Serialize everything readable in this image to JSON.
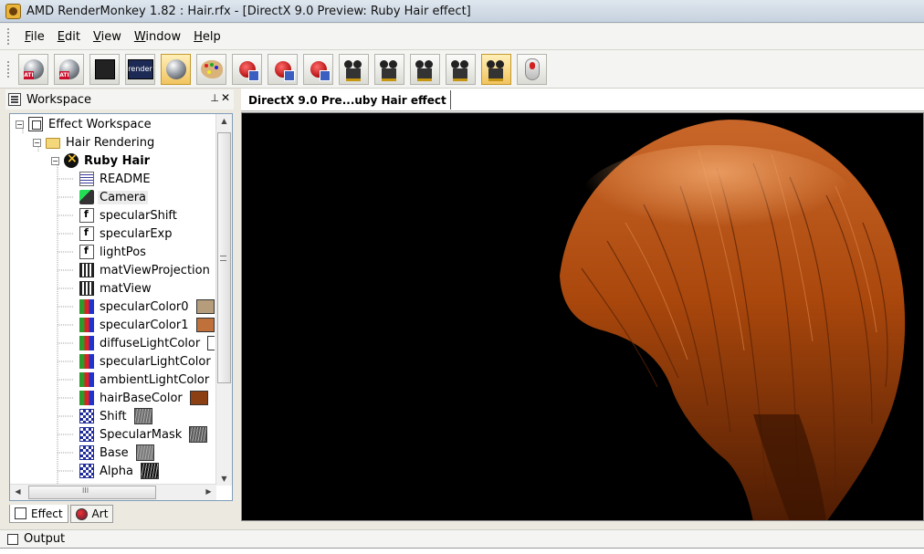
{
  "window": {
    "title": "AMD RenderMonkey 1.82 : Hair.rfx - [DirectX 9.0 Preview: Ruby Hair effect]"
  },
  "menu": [
    {
      "key": "F",
      "rest": "ile"
    },
    {
      "key": "E",
      "rest": "dit"
    },
    {
      "key": "V",
      "rest": "iew"
    },
    {
      "key": "W",
      "rest": "indow"
    },
    {
      "key": "H",
      "rest": "elp"
    }
  ],
  "toolbar": {
    "render_label": "render",
    "ati_badge": "ATI"
  },
  "workspace": {
    "title": "Workspace",
    "pin_glyph": "⊥",
    "close_glyph": "✕",
    "tree": [
      {
        "label": "Effect Workspace",
        "icon": "workspace-icon",
        "level": 0
      },
      {
        "label": "Hair Rendering",
        "icon": "folder-icon",
        "level": 1
      },
      {
        "label": "Ruby Hair",
        "icon": "effect-icon",
        "level": 2
      },
      {
        "label": "README",
        "icon": "readme-icon",
        "level": 3
      },
      {
        "label": "Camera",
        "icon": "camera-icon",
        "level": 3
      },
      {
        "label": "specularShift",
        "icon": "scalar-icon",
        "level": 3
      },
      {
        "label": "specularExp",
        "icon": "scalar-icon",
        "level": 3
      },
      {
        "label": "lightPos",
        "icon": "scalar-icon",
        "level": 3
      },
      {
        "label": "matViewProjection",
        "icon": "matrix-icon",
        "level": 3
      },
      {
        "label": "matView",
        "icon": "matrix-icon",
        "level": 3
      },
      {
        "label": "specularColor0",
        "icon": "color-icon",
        "level": 3,
        "swatch": "#b59d7c"
      },
      {
        "label": "specularColor1",
        "icon": "color-icon",
        "level": 3,
        "swatch": "#c0703a"
      },
      {
        "label": "diffuseLightColor",
        "icon": "color-icon",
        "level": 3,
        "swatch": "#ffffff"
      },
      {
        "label": "specularLightColor",
        "icon": "color-icon",
        "level": 3,
        "swatch": "#ffffff"
      },
      {
        "label": "ambientLightColor",
        "icon": "color-icon",
        "level": 3,
        "swatch": "#ffffff"
      },
      {
        "label": "hairBaseColor",
        "icon": "color-icon",
        "level": 3,
        "swatch": "#8c3f12"
      },
      {
        "label": "Shift",
        "icon": "texture-icon",
        "level": 3,
        "thumb": "#6c6c6c"
      },
      {
        "label": "SpecularMask",
        "icon": "texture-icon",
        "level": 3,
        "thumb": "#5a5a5a"
      },
      {
        "label": "Base",
        "icon": "texture-icon",
        "level": 3,
        "thumb": "#7a7a7a"
      },
      {
        "label": "Alpha",
        "icon": "texture-icon",
        "level": 3,
        "thumb": "#111111"
      }
    ],
    "tabs": [
      {
        "label": "Effect",
        "icon": "effect-tab-icon"
      },
      {
        "label": "Art",
        "icon": "art-tab-icon"
      }
    ],
    "scroll_glyph": "III"
  },
  "preview": {
    "tab_label": "DirectX 9.0 Pre...uby Hair effect",
    "background": "#000000",
    "hair_color": "#a9470c"
  },
  "output": {
    "label": "Output"
  }
}
